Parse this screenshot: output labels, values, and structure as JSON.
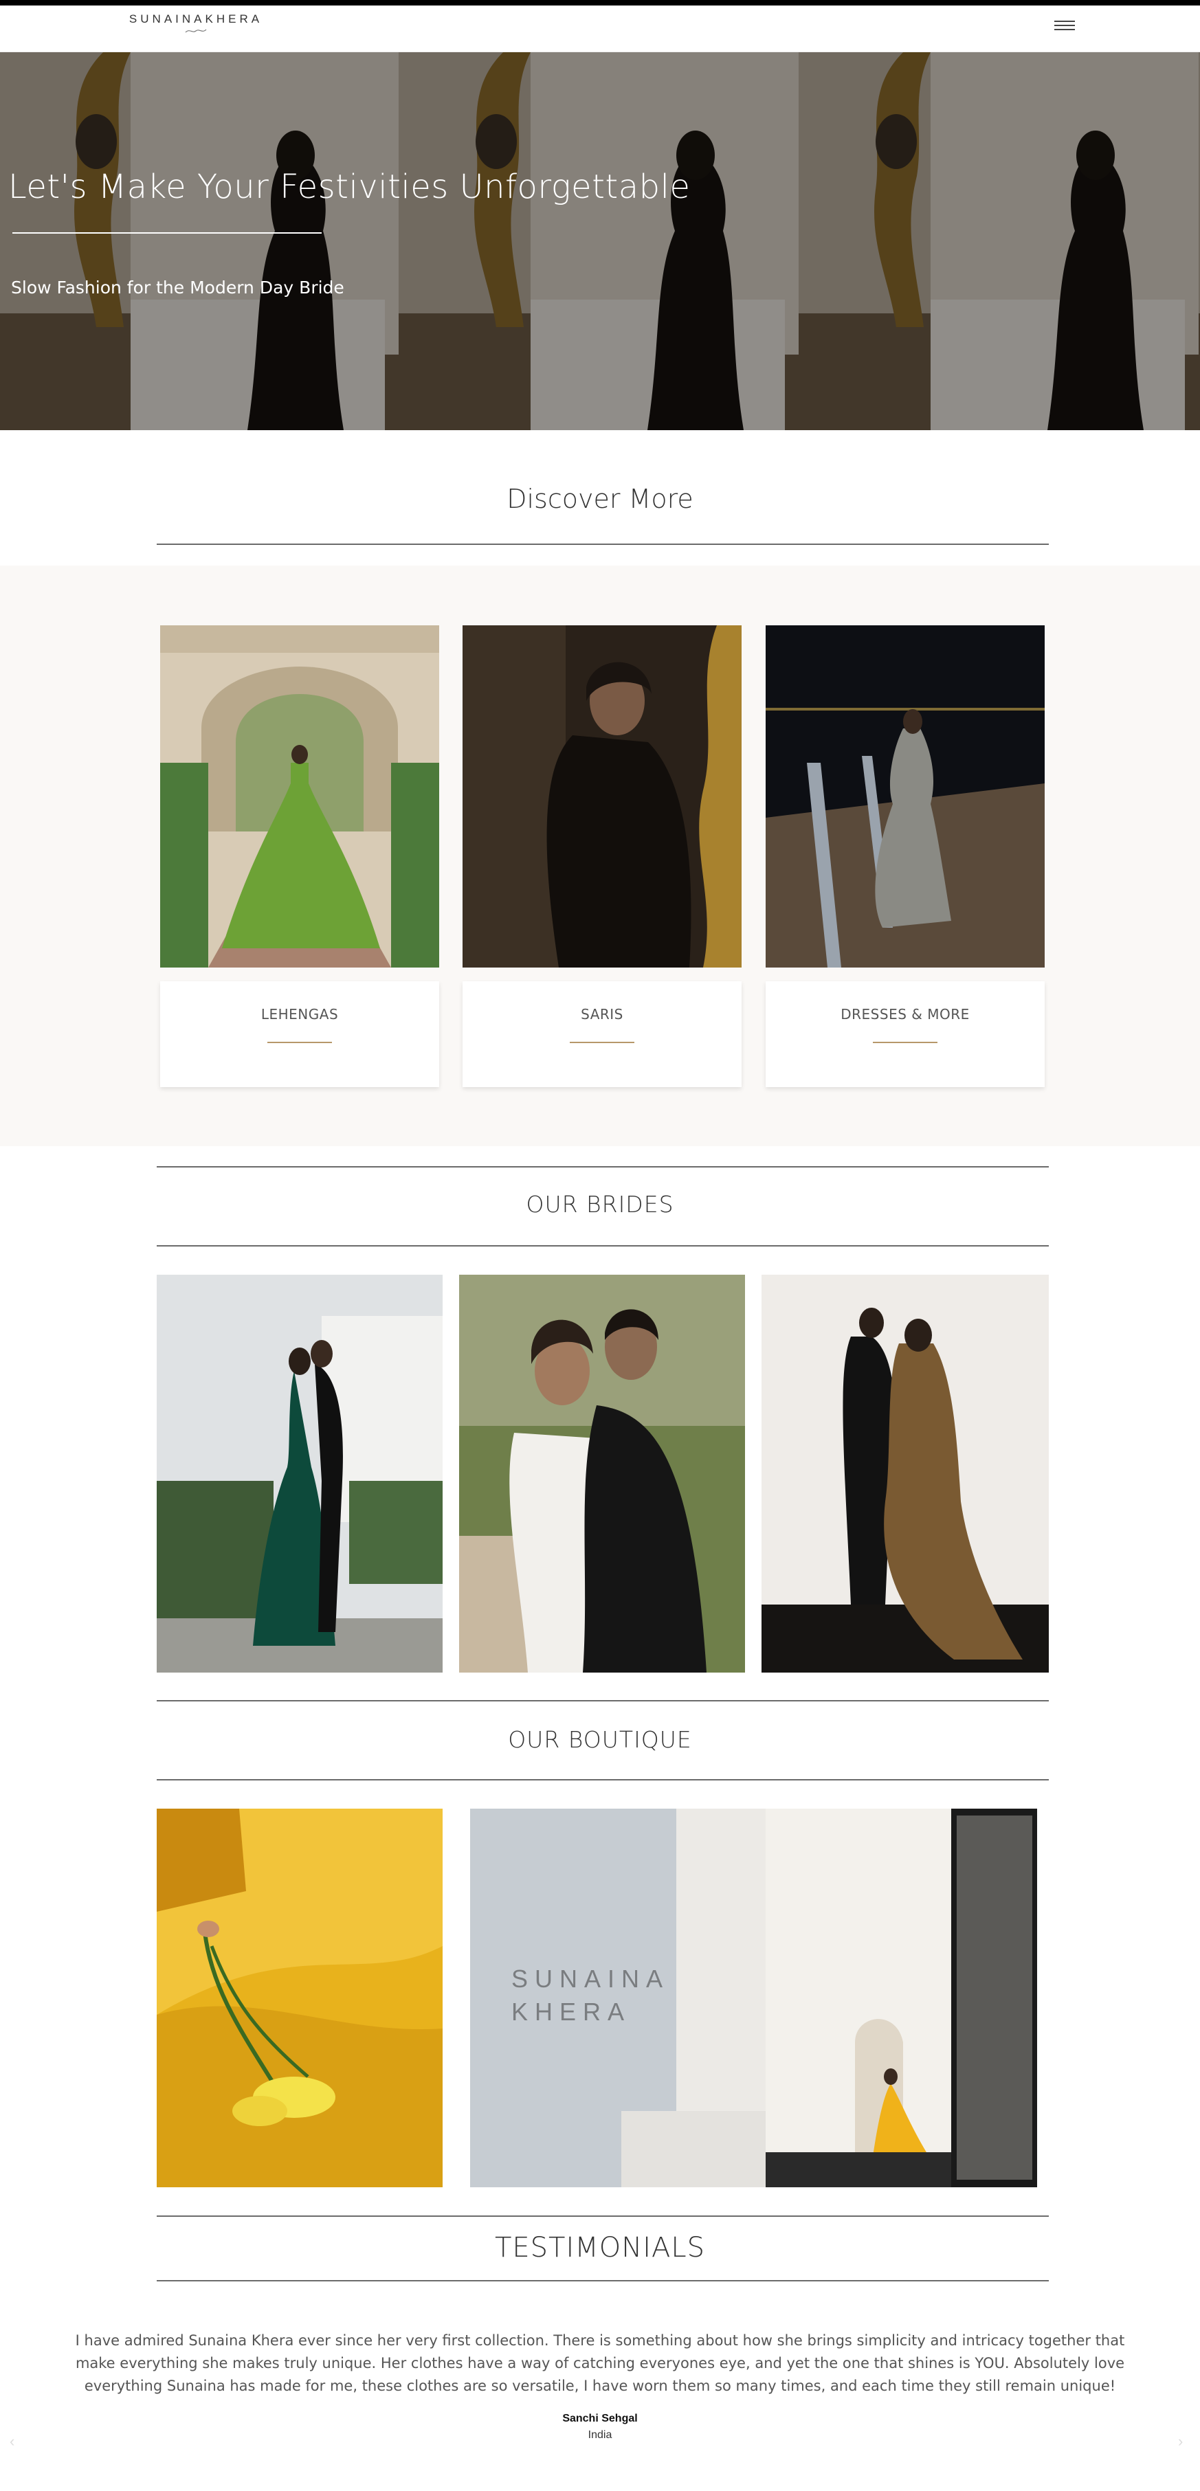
{
  "brand": {
    "logo_text": "SUNAINAKHERA"
  },
  "header": {
    "menu_icon": "hamburger-menu-icon"
  },
  "hero": {
    "title": "Let's Make Your Festivities Unforgettable",
    "subtitle": "Slow Fashion for the Modern Day Bride"
  },
  "discover": {
    "title": "Discover More",
    "collections": [
      {
        "label": "LEHENGAS"
      },
      {
        "label": "SARIS"
      },
      {
        "label": "DRESSES & MORE"
      }
    ]
  },
  "brides": {
    "title": "OUR BRIDES"
  },
  "boutique": {
    "title": "OUR BOUTIQUE",
    "sign_line1": "SUNAINA",
    "sign_line2": "KHERA"
  },
  "testimonials": {
    "title": "TESTIMONIALS",
    "quote": "I have admired Sunaina Khera ever since her very first collection. There is something about how she brings simplicity and intricacy together that make everything she makes truly unique. Her clothes have a way of catching everyones eye, and yet the one that shines is YOU. Absolutely love everything Sunaina has made for me, these clothes are so versatile, I have worn them so many times, and each time they still remain unique!",
    "name": "Sanchi Sehgal",
    "location": "India",
    "prev_arrow": "‹",
    "next_arrow": "›"
  },
  "colors": {
    "accent": "#b7986a",
    "hero_overlay": "#000000",
    "text": "#333333"
  }
}
